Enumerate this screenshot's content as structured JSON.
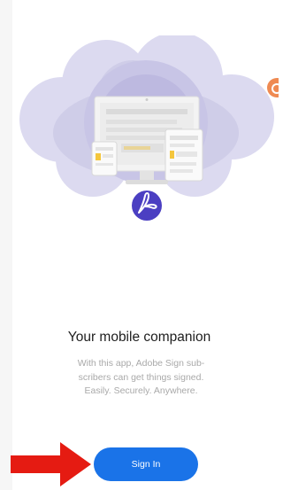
{
  "onboarding": {
    "title": "Your mobile companion",
    "description_lines": [
      "With this app, Adobe Sign sub-",
      "scribers can get things signed.",
      "Easily. Securely. Anywhere."
    ],
    "sign_in_label": "Sign In"
  },
  "colors": {
    "primary_button": "#1a73e8",
    "cloud": "#cfcde8",
    "badge": "#4b3fc2",
    "arrow": "#e51b12",
    "edge_icon": "#ef8a52"
  },
  "icons": {
    "badge": "acrobat-icon",
    "edge": "app-icon-partial",
    "annotation": "red-arrow"
  }
}
